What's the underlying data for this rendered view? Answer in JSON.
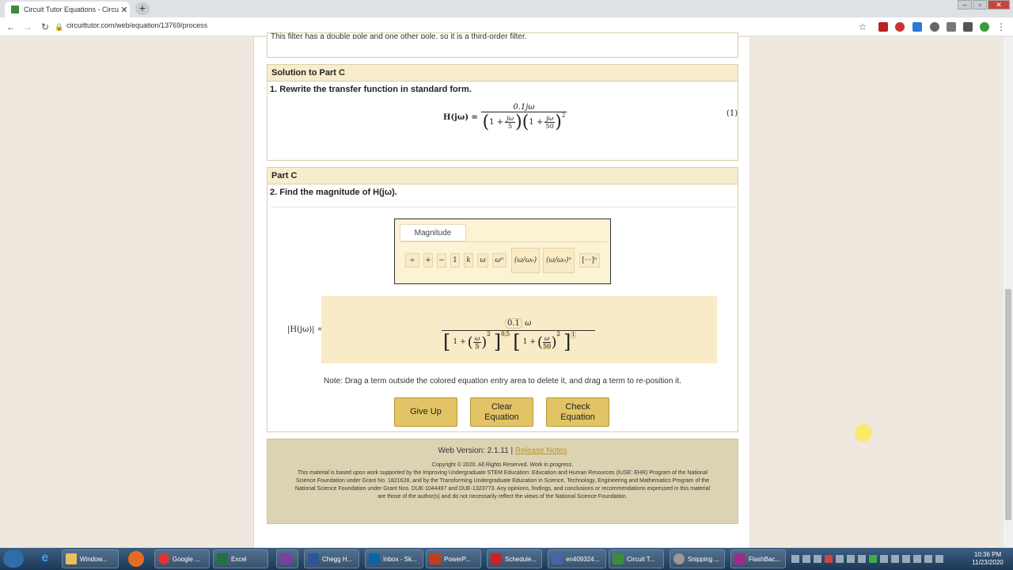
{
  "browser": {
    "tab_title": "Circuit Tutor Equations - Circuit T",
    "url": "circuittutor.com/web/equation/13769/process",
    "new_tab": "+",
    "close_tab": "✕"
  },
  "page": {
    "top_cut_text": "This filter has a double pole and one other pole, so it is a third-order filter.",
    "solution": {
      "header": "Solution to Part C",
      "step": "1. Rewrite the transfer function in standard form.",
      "eq_lhs": "H(jω) =",
      "eq_num": "0.1jω",
      "eq_f1": "1 +",
      "eq_f1_num": "jω",
      "eq_f1_den": "5",
      "eq_f2": "1 +",
      "eq_f2_num": "jω",
      "eq_f2_den": "50",
      "eq_exp": "2",
      "eq_tag": "(1)"
    },
    "part_c": {
      "header": "Part C",
      "step": "2. Find the magnitude of H(jω).",
      "palette_tab": "Magnitude",
      "palette_items": [
        "÷",
        "+",
        "−",
        "1",
        "k",
        "ω",
        "ωⁿ",
        "(ω/ω₀)",
        "(ω/ω₀)ⁿ",
        "[···]ⁿ"
      ],
      "answer_lhs": "|H(jω)| =",
      "ans_coef": "0.1",
      "ans_omega": "ω",
      "ans_one_a": "1",
      "ans_plus_a": "+",
      "ans_w_a": "ω",
      "ans_d_a": "5",
      "ans_e2_a": "2",
      "ans_e05": "0.5",
      "ans_one_b": "1",
      "ans_plus_b": "+",
      "ans_w_b": "ω",
      "ans_d_b": "50",
      "ans_e2_b": "2",
      "ans_e1": "1",
      "note": "Note: Drag a term outside the colored equation entry area to delete it, and drag a term to re-position it.",
      "buttons": {
        "give_up": "Give Up",
        "clear": "Clear Equation",
        "check": "Check Equation"
      }
    },
    "footer": {
      "version": "Web Version: 2.1.11 |",
      "release_link": "Release Notes",
      "copyright": "Copyright © 2020. All Rights Reserved. Work in progress.",
      "body": "This material is based upon work supported by the Improving Undergraduate STEM Education: Education and Human Resources (IUSE: EHR) Program of the National Science Foundation under Grant No. 1821628, and by the Transforming Undergraduate Education in Science, Technology, Engineering and Mathematics Program of the National Science Foundation under Grant Nos. DUE-1044497 and DUE-1323773. Any opinions, findings, and conclusions or recommendations expressed in this material are those of the author(s) and do not necessarily reflect the views of the National Science Foundation."
    }
  },
  "taskbar": {
    "items": [
      "Window...",
      "Google ...",
      "Excel",
      "Chegg H...",
      "Inbox - Sk...",
      "PowerP...",
      "Schedule...",
      "en409324...",
      "Circuit T...",
      "Snipping ...",
      "FlashBac..."
    ],
    "time": "10:36 PM",
    "date": "11/23/2020"
  },
  "colors": {
    "accent": "#e2c466",
    "header_bg": "#f7edcd",
    "entry_bg": "#f8ebc7"
  }
}
